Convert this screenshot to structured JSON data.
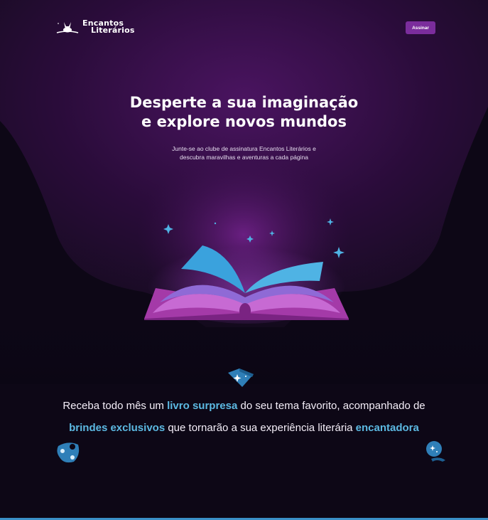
{
  "header": {
    "logo_line1": "Encantos",
    "logo_line2": "Literários",
    "logo_icon": "rabbit-icon",
    "cta_label": "Assinar"
  },
  "hero": {
    "title_line1": "Desperte a sua imaginação",
    "title_line2": "e explore novos mundos",
    "subtitle_line1": "Junte-se ao clube de assinatura Encantos Literários e",
    "subtitle_line2": "descubra maravilhas e aventuras a cada página",
    "illustration": "open-book-with-sparkles"
  },
  "feature": {
    "line1_part1": "Receba todo mês um ",
    "line1_highlight": "livro surpresa",
    "line1_part2": " do seu tema favorito, acompanhado de",
    "line2_highlight1": "brindes exclusivos",
    "line2_part": " que tornarão a sua experiência literária ",
    "line2_highlight2": "encantadora",
    "icons": [
      "magic-book-icon",
      "potion-palette-icon",
      "crystal-ball-icon"
    ]
  },
  "colors": {
    "background": "#0d0716",
    "glow": "#5a1a6e",
    "accent_purple": "#7b2d9c",
    "accent_blue": "#5cb9e2"
  }
}
